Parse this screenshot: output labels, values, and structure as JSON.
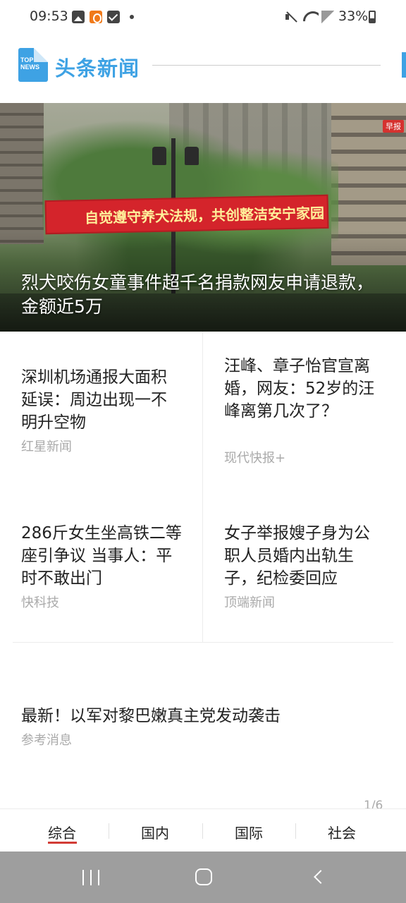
{
  "status": {
    "time": "09:53",
    "battery": "33%",
    "icons": [
      "gallery-icon",
      "app-notification-icon",
      "check-icon",
      "dot-icon",
      "mute-icon",
      "wifi-icon",
      "signal-icon",
      "battery-icon"
    ]
  },
  "header": {
    "logo_text": "TOP NEWS",
    "title": "头条新闻"
  },
  "hero": {
    "badge": "早报",
    "banner_text": "自觉遵守养犬法规，共创整洁安宁家园",
    "headline": "烈犬咬伤女童事件超千名捐款网友申请退款，金额近5万"
  },
  "news": [
    {
      "title": "深圳机场通报大面积延误：周边出现一不明升空物",
      "source": "红星新闻"
    },
    {
      "title": "汪峰、章子怡官宣离婚，网友：52岁的汪峰离第几次了？",
      "source": "现代快报+"
    },
    {
      "title": "286斤女生坐高铁二等座引争议 当事人：平时不敢出门",
      "source": "快科技"
    },
    {
      "title": "女子举报嫂子身为公职人员婚内出轨生子，纪检委回应",
      "source": "顶端新闻"
    },
    {
      "title": "最新！以军对黎巴嫩真主党发动袭击",
      "source": "参考消息"
    }
  ],
  "pager": "1/6",
  "tabs": [
    "综合",
    "国内",
    "国际",
    "社会"
  ],
  "active_tab": "综合",
  "colors": {
    "brand": "#3ea2e4",
    "accent": "#d23b35"
  },
  "nav_icons": [
    "recents-icon",
    "home-icon",
    "back-icon"
  ]
}
